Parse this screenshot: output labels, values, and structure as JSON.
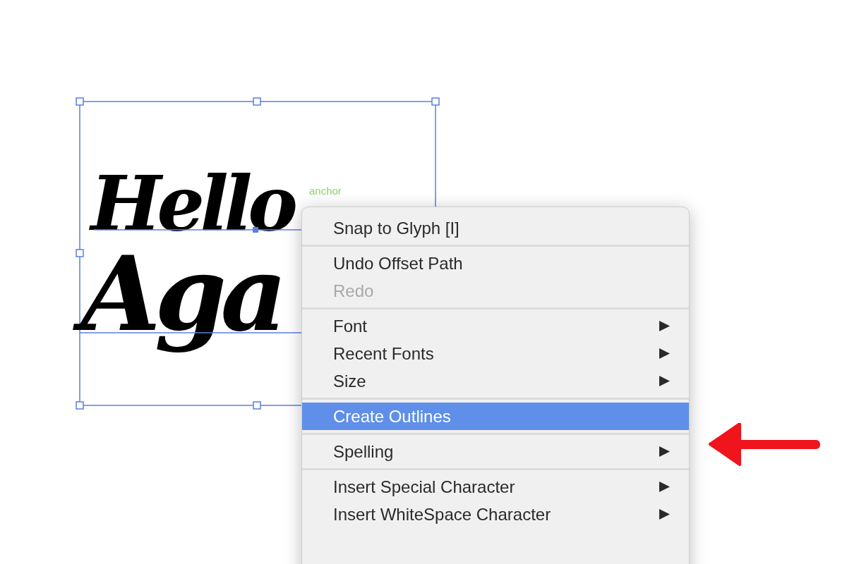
{
  "canvas": {
    "text_lines": [
      "Hello",
      "Aga"
    ],
    "anchor_label": "anchor"
  },
  "context_menu": {
    "groups": [
      [
        {
          "label": "Snap to Glyph [I]",
          "disabled": false,
          "selected": false,
          "has_submenu": false
        }
      ],
      [
        {
          "label": "Undo Offset Path",
          "disabled": false,
          "selected": false,
          "has_submenu": false
        },
        {
          "label": "Redo",
          "disabled": true,
          "selected": false,
          "has_submenu": false
        }
      ],
      [
        {
          "label": "Font",
          "disabled": false,
          "selected": false,
          "has_submenu": true
        },
        {
          "label": "Recent Fonts",
          "disabled": false,
          "selected": false,
          "has_submenu": true
        },
        {
          "label": "Size",
          "disabled": false,
          "selected": false,
          "has_submenu": true
        }
      ],
      [
        {
          "label": "Create Outlines",
          "disabled": false,
          "selected": true,
          "has_submenu": false
        }
      ],
      [
        {
          "label": "Spelling",
          "disabled": false,
          "selected": false,
          "has_submenu": true
        }
      ],
      [
        {
          "label": "Insert Special Character",
          "disabled": false,
          "selected": false,
          "has_submenu": true
        },
        {
          "label": "Insert WhiteSpace Character",
          "disabled": false,
          "selected": false,
          "has_submenu": true
        }
      ]
    ]
  }
}
